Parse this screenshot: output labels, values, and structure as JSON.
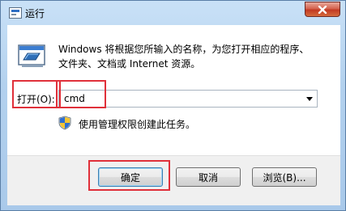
{
  "window": {
    "title": "运行"
  },
  "dialog": {
    "description_line1": "Windows 将根据您所输入的名称，为您打开相应的程序、",
    "description_line2": "文件夹、文档或 Internet 资源。",
    "open_label": "打开(O):",
    "open_value": "cmd",
    "admin_note": "使用管理权限创建此任务。"
  },
  "buttons": {
    "ok": "确定",
    "cancel": "取消",
    "browse": "浏览(B)..."
  },
  "colors": {
    "highlight": "#e0303a",
    "title_gradient": "#b3d1ee",
    "close_button": "#c23a22"
  },
  "icons": [
    "run-icon",
    "close-icon",
    "chevron-down-icon",
    "uac-shield-icon"
  ]
}
